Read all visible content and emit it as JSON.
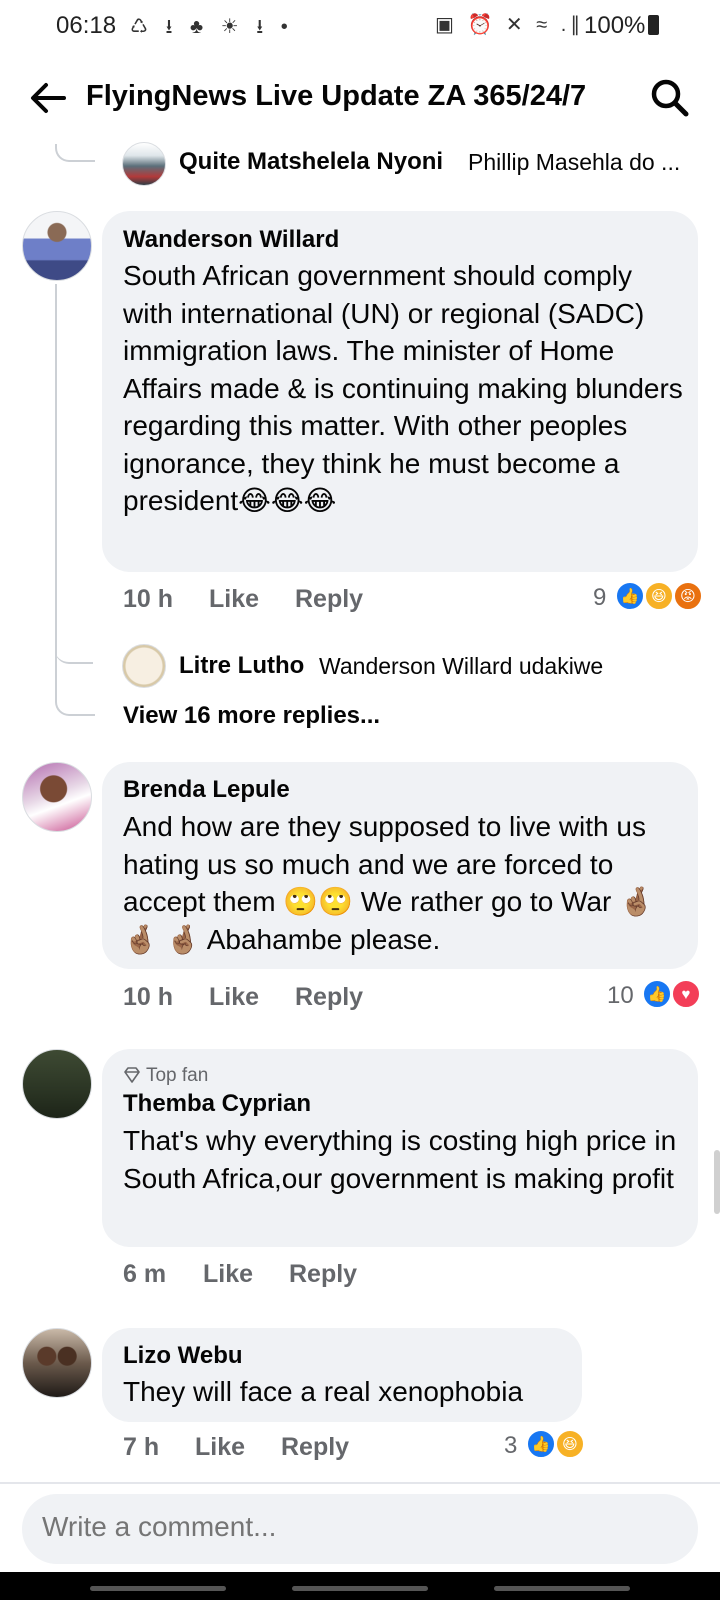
{
  "status_bar": {
    "time": "06:18",
    "left_icons": "♺ ⭳ ♣ ☀ ⭳ •",
    "right_icons": "▣ ⏰ ✕ ≈ .∥",
    "battery": "100%"
  },
  "header": {
    "title": "FlyingNews Live Update ZA 365/24/7"
  },
  "comments": [
    {
      "author": "Wanderson Willard",
      "text": "South African government should comply with international (UN) or regional (SADC) immigration laws. The minister of Home Affairs made & is continuing making blunders regarding this matter. With other peoples ignorance, they think he must become a president😂😂😂",
      "time": "10 h",
      "like_label": "Like",
      "reply_label": "Reply",
      "reactions_count": "9"
    },
    {
      "author": "Brenda Lepule",
      "text": "And how are they supposed to live with us hating us so much and we are forced to accept them 🙄🙄 We rather go to War 🤞🏽 🤞🏽 🤞🏽 Abahambe please.",
      "time": "10 h",
      "like_label": "Like",
      "reply_label": "Reply",
      "reactions_count": "10"
    },
    {
      "badge": "Top fan",
      "author": "Themba Cyprian",
      "text": "That's why everything is costing high price in South Africa,our government is making profit",
      "time": "6 m",
      "like_label": "Like",
      "reply_label": "Reply"
    },
    {
      "author": "Lizo Webu",
      "text": "They will face a real xenophobia",
      "time": "7 h",
      "like_label": "Like",
      "reply_label": "Reply",
      "reactions_count": "3"
    }
  ],
  "replies": [
    {
      "author": "Quite Matshelela Nyoni",
      "text": "Phillip Masehla do ..."
    },
    {
      "author": "Litre Lutho",
      "text": "Wanderson Willard udakiwe"
    }
  ],
  "view_more": "View 16 more replies...",
  "composer": {
    "placeholder": "Write a comment..."
  },
  "colors": {
    "like_blue": "#1877f2",
    "bubble_bg": "#f0f2f5",
    "meta_gray": "#65676b"
  }
}
